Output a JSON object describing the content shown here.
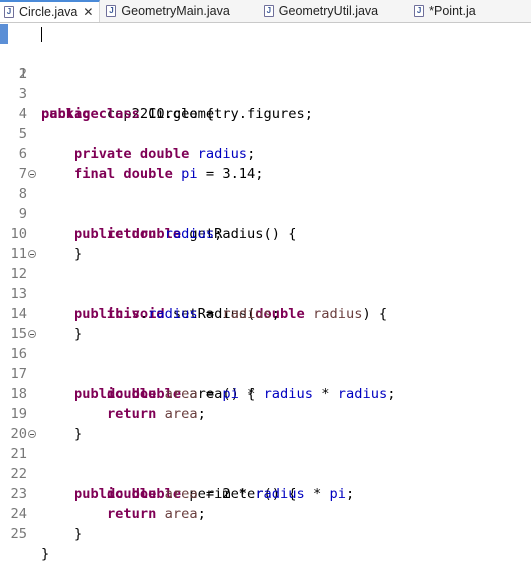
{
  "tabs": [
    {
      "label": "Circle.java",
      "active": true,
      "icon": "java-file-icon",
      "closable": true
    },
    {
      "label": "GeometryMain.java",
      "active": false,
      "icon": "java-file-icon"
    },
    {
      "label": "GeometryUtil.java",
      "active": false,
      "icon": "java-file-icon"
    },
    {
      "label": "*Point.ja",
      "active": false,
      "icon": "java-file-icon"
    }
  ],
  "colors": {
    "keyword": "#7f0055",
    "field": "#0000c0",
    "local_variable": "#6a3e3e",
    "line_number": "#787878",
    "active_tab_accent": "#4a8ad8"
  },
  "code": {
    "line_numbers": [
      "1",
      "2",
      "3",
      "4",
      "5",
      "6",
      "7",
      "8",
      "9",
      "10",
      "11",
      "12",
      "13",
      "14",
      "15",
      "16",
      "17",
      "18",
      "19",
      "20",
      "21",
      "22",
      "23",
      "24",
      "25"
    ],
    "tokens": {
      "package": "package",
      "package_name": " cop2210.geometry.figures;",
      "public": "public",
      "class": "class",
      "class_decl": " Circle {",
      "private": "private",
      "double": "double",
      "final": "final",
      "void": "void",
      "return": "return",
      "this": "this",
      "radius": "radius",
      "pi": "pi",
      "area": "area",
      "this_dot": ".",
      "pi_init": " = 3.14;",
      "semicolon": ";",
      "getRadius_sig": " getRadius() {",
      "setRadius_sig": " setRadius(",
      "setRadius_end": ") {",
      "assign": " = ",
      "area_sig": " area() {",
      "times": " * ",
      "perimeter_sig": " perimeter() {",
      "two_times": " = 2 * ",
      "close_brace": "}"
    }
  }
}
